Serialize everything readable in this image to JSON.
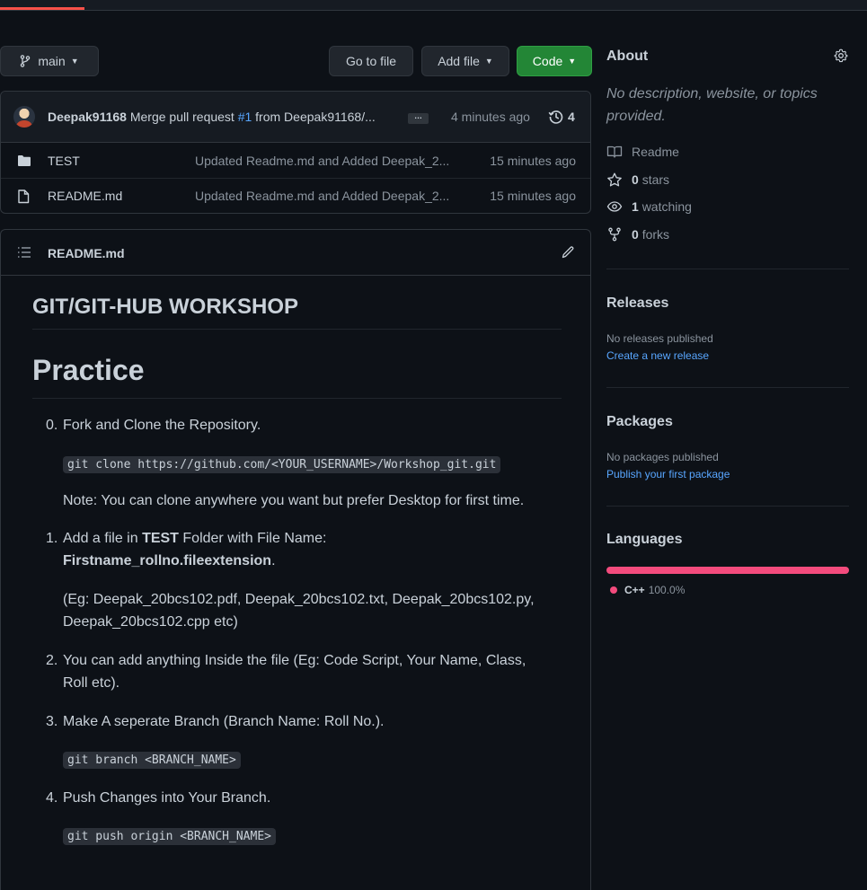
{
  "toolbar": {
    "branch_label": "main",
    "go_to_file_label": "Go to file",
    "add_file_label": "Add file",
    "code_label": "Code"
  },
  "commit": {
    "author": "Deepak91168",
    "message_prefix": "Merge pull request",
    "pr_ref": "#1",
    "message_suffix": "from Deepak91168/...",
    "ellipsis": "…",
    "time": "4 minutes ago",
    "history_count": "4"
  },
  "files": [
    {
      "name": "TEST",
      "type": "folder",
      "message": "Updated Readme.md and Added Deepak_2...",
      "time": "15 minutes ago"
    },
    {
      "name": "README.md",
      "type": "file",
      "message": "Updated Readme.md and Added Deepak_2...",
      "time": "15 minutes ago"
    }
  ],
  "readme": {
    "header_title": "README.md",
    "h2": "GIT/GIT-HUB WORKSHOP",
    "h1": "Practice",
    "item0": {
      "num": "0.",
      "text": "Fork and Clone the Repository."
    },
    "code0": "git clone https://github.com/<YOUR_USERNAME>/Workshop_git.git",
    "note0": "Note: You can clone anywhere you want but prefer Desktop for first time.",
    "item1": {
      "num": "1.",
      "pre": "Add a file in ",
      "bold1": "TEST",
      "mid": " Folder with File Name:",
      "bold2": "Firstname_rollno.fileextension",
      "post": "."
    },
    "example1_line1": "(Eg: Deepak_20bcs102.pdf, Deepak_20bcs102.txt, Deepak_20bcs102.py,",
    "example1_line2": "Deepak_20bcs102.cpp etc)",
    "item2": {
      "num": "2.",
      "line1": "You can add anything Inside the file (Eg: Code Script, Your Name, Class,",
      "line2": "Roll etc)."
    },
    "item3": {
      "num": "3.",
      "text": "Make A seperate Branch (Branch Name: Roll No.)."
    },
    "code3": "git branch <BRANCH_NAME>",
    "item4": {
      "num": "4.",
      "text": "Push Changes into Your Branch."
    },
    "code4": "git push origin <BRANCH_NAME>"
  },
  "about": {
    "title": "About",
    "desc_line1": "No description, website, or topics",
    "desc_line2": "provided.",
    "readme_label": "Readme",
    "stars_count": "0",
    "stars_label": "stars",
    "watching_count": "1",
    "watching_label": "watching",
    "forks_count": "0",
    "forks_label": "forks"
  },
  "releases": {
    "title": "Releases",
    "none": "No releases published",
    "create_link": "Create a new release"
  },
  "packages": {
    "title": "Packages",
    "none": "No packages published",
    "publish_link": "Publish your first package"
  },
  "languages": {
    "title": "Languages",
    "items": [
      {
        "name": "C++",
        "percent": "100.0%",
        "share": 1.0,
        "color": "#f34b7d"
      }
    ]
  },
  "colors": {
    "background": "#0d1117",
    "accent_green": "#238636",
    "link": "#58a6ff",
    "cpp": "#f34b7d"
  }
}
